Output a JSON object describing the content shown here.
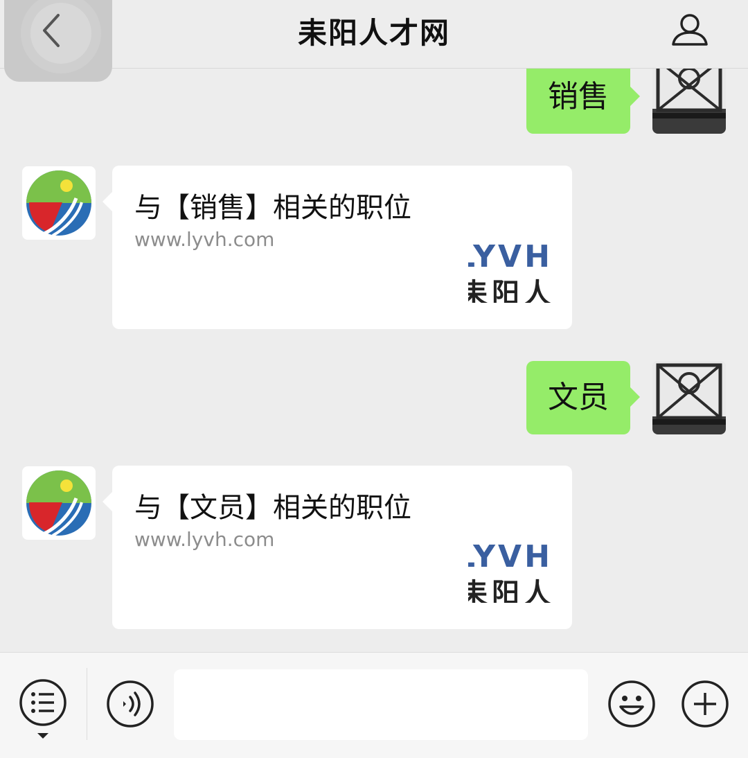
{
  "header": {
    "title": "耒阳人才网"
  },
  "messages": [
    {
      "side": "right",
      "text": "销售"
    },
    {
      "side": "left",
      "card_title": "与【销售】相关的职位",
      "card_url": "www.lyvh.com",
      "logo_text_1": "LYVH",
      "logo_text_2": "耒阳人"
    },
    {
      "side": "right",
      "text": "文员"
    },
    {
      "side": "left",
      "card_title": "与【文员】相关的职位",
      "card_url": "www.lyvh.com",
      "logo_text_1": "LYVH",
      "logo_text_2": "耒阳人"
    }
  ],
  "input": {
    "placeholder": ""
  },
  "colors": {
    "background": "#ededed",
    "sent_bubble": "#95ec69",
    "card": "#ffffff",
    "logo_blue": "#3a5fa0"
  },
  "icons": [
    "back-icon",
    "profile-icon",
    "menu-icon",
    "voice-icon",
    "emoji-icon",
    "plus-icon"
  ]
}
